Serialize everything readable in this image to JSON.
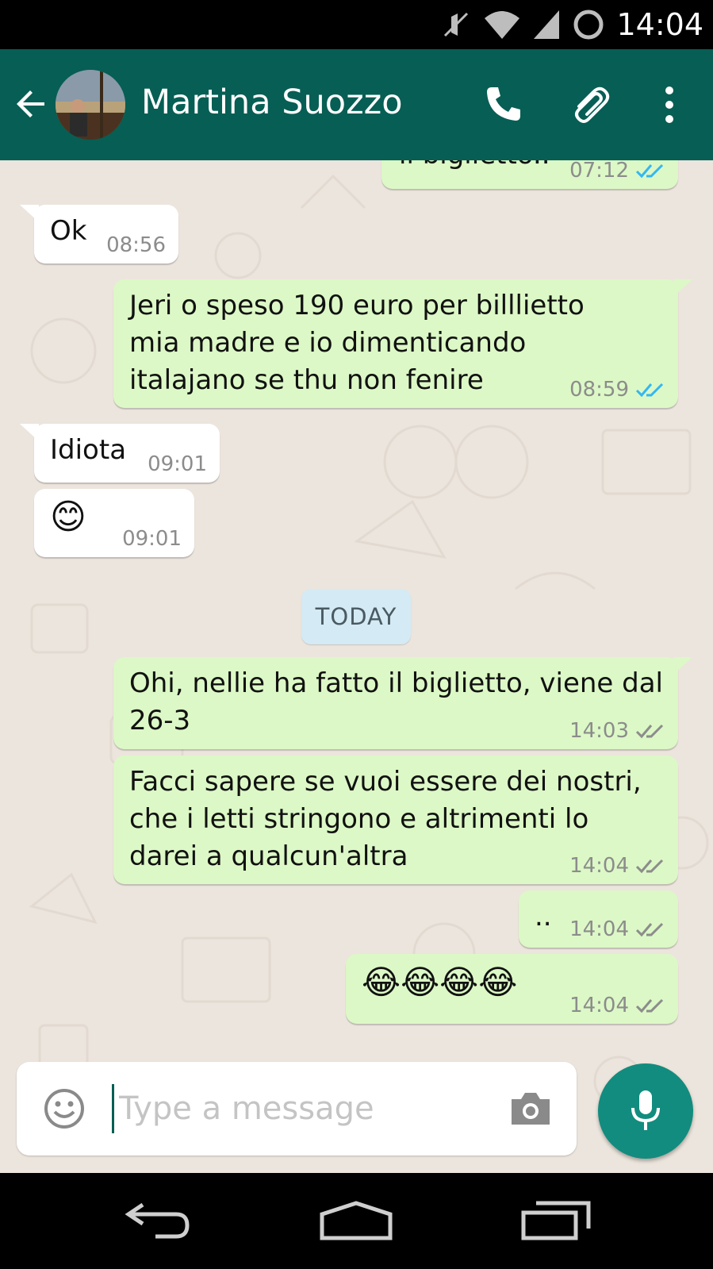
{
  "status_bar": {
    "time": "14:04",
    "icons": [
      "mute-icon",
      "wifi-icon",
      "signal-icon",
      "sync-icon"
    ]
  },
  "header": {
    "contact_name": "Martina Suozzo",
    "icons": [
      "back-arrow-icon",
      "phone-icon",
      "attach-icon",
      "more-vert-icon"
    ],
    "color": "#075E54"
  },
  "messages": [
    {
      "direction": "out",
      "text": "il biglietto..",
      "time": "07:12",
      "status": "read"
    },
    {
      "direction": "in",
      "text": "Ok",
      "time": "08:56"
    },
    {
      "direction": "out",
      "text": "Jeri o speso 190 euro per billlietto\nmia madre e io dimenticando\nitalajano se thu non fenire",
      "time": "08:59",
      "status": "read"
    },
    {
      "direction": "in",
      "text": "Idiota",
      "time": "09:01"
    },
    {
      "direction": "in",
      "text": "😊",
      "time": "09:01"
    },
    {
      "direction": "out",
      "text": "Ohi, nellie ha fatto il biglietto, viene dal\n26-3",
      "time": "14:03",
      "status": "delivered"
    },
    {
      "direction": "out",
      "text": "Facci sapere se vuoi essere dei nostri,\nche i letti stringono e altrimenti lo\ndarei a qualcun'altra",
      "time": "14:04",
      "status": "delivered"
    },
    {
      "direction": "out",
      "text": "..",
      "time": "14:04",
      "status": "delivered"
    },
    {
      "direction": "out",
      "text": "😂😂😂😂",
      "time": "14:04",
      "status": "delivered"
    }
  ],
  "date_divider": "TODAY",
  "composer": {
    "placeholder": "Type a message",
    "value": ""
  },
  "colors": {
    "incoming_bubble": "#ffffff",
    "outgoing_bubble": "#dcf8c6",
    "read_tick": "#34b7f1",
    "delivered_tick": "#8c8c8c",
    "chat_background": "#ece5dd",
    "fab": "#128C7E"
  },
  "nav_bar": {
    "icons": [
      "nav-back-icon",
      "nav-home-icon",
      "nav-recents-icon"
    ]
  }
}
